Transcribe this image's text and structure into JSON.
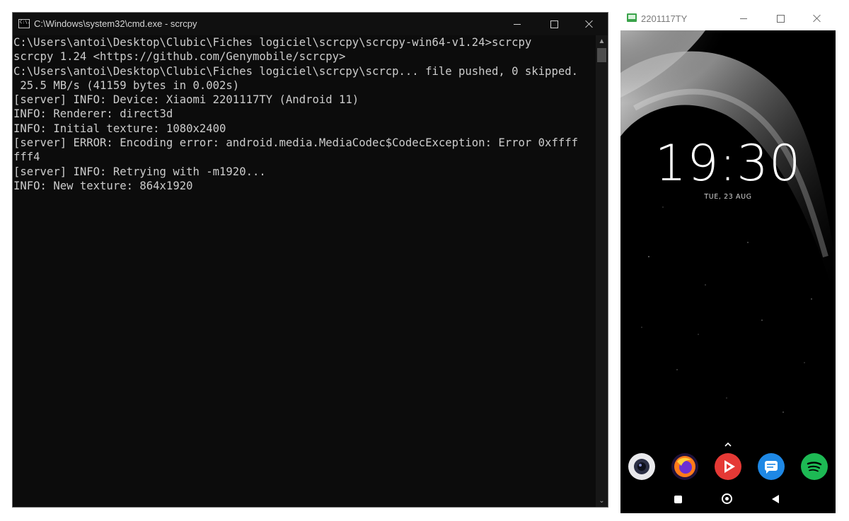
{
  "cmd_window": {
    "title": "C:\\Windows\\system32\\cmd.exe - scrcpy",
    "icon_label": "C:\\.",
    "controls": {
      "minimize": "minimize-icon",
      "maximize": "maximize-icon",
      "close": "close-icon"
    },
    "lines": [
      "C:\\Users\\antoi\\Desktop\\Clubic\\Fiches logiciel\\scrcpy\\scrcpy-win64-v1.24>scrcpy",
      "scrcpy 1.24 <https://github.com/Genymobile/scrcpy>",
      "C:\\Users\\antoi\\Desktop\\Clubic\\Fiches logiciel\\scrcpy\\scrcp... file pushed, 0 skipped.",
      " 25.5 MB/s (41159 bytes in 0.002s)",
      "[server] INFO: Device: Xiaomi 2201117TY (Android 11)",
      "INFO: Renderer: direct3d",
      "INFO: Initial texture: 1080x2400",
      "[server] ERROR: Encoding error: android.media.MediaCodec$CodecException: Error 0xffff",
      "fff4",
      "[server] INFO: Retrying with -m1920...",
      "INFO: New texture: 864x1920"
    ]
  },
  "phone_window": {
    "title": "2201117TY",
    "controls": {
      "minimize": "minimize-icon",
      "maximize": "maximize-icon",
      "close": "close-icon"
    },
    "lockscreen": {
      "time": "19:30",
      "date": "TUE, 23 AUG"
    },
    "dock_apps": [
      {
        "icon": "camera-icon",
        "color": "#e9e9ec"
      },
      {
        "icon": "firefox-icon",
        "color": "#ff7a1a"
      },
      {
        "icon": "youtube-vanced-icon",
        "color": "#e53935"
      },
      {
        "icon": "messages-icon",
        "color": "#1e88e5"
      },
      {
        "icon": "spotify-icon",
        "color": "#1db954"
      }
    ],
    "nav": {
      "recents": "recents-icon",
      "home": "home-icon",
      "back": "back-icon"
    }
  }
}
